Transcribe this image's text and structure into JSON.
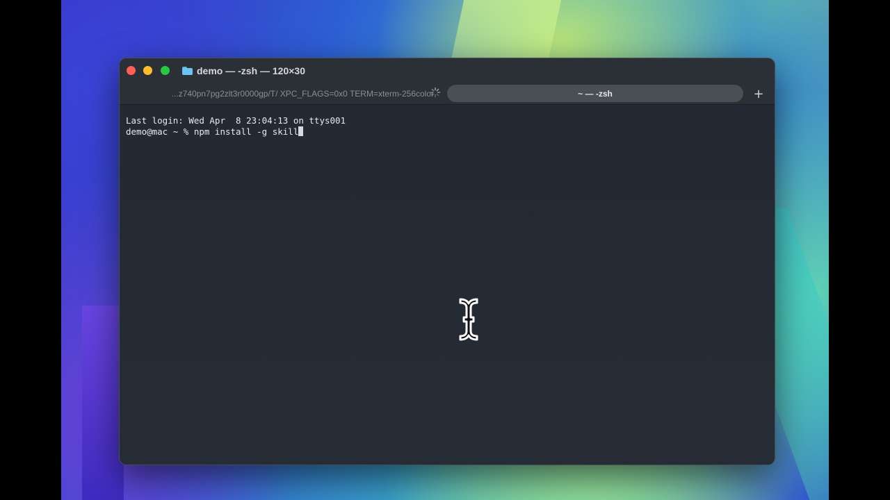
{
  "window": {
    "title": "demo — -zsh — 120×30"
  },
  "tabs": {
    "inactive_label": "...z740pn7pg2zlt3r0000gp/T/ XPC_FLAGS=0x0 TERM=xterm-256color",
    "active_label": "~ — -zsh",
    "new_tab_label": "+"
  },
  "terminal": {
    "line1": "Last login: Wed Apr  8 23:04:13 on ttys001",
    "line2": "demo@mac ~ % npm install -g skill"
  },
  "icons": {
    "folder": "folder-icon",
    "spinner": "activity-spinner-icon",
    "cursor": "text-ibeam-cursor-icon"
  },
  "colors": {
    "close": "#fe5f57",
    "minimize": "#febc2e",
    "maximize": "#28c840",
    "terminal_bg": "#242a33"
  }
}
